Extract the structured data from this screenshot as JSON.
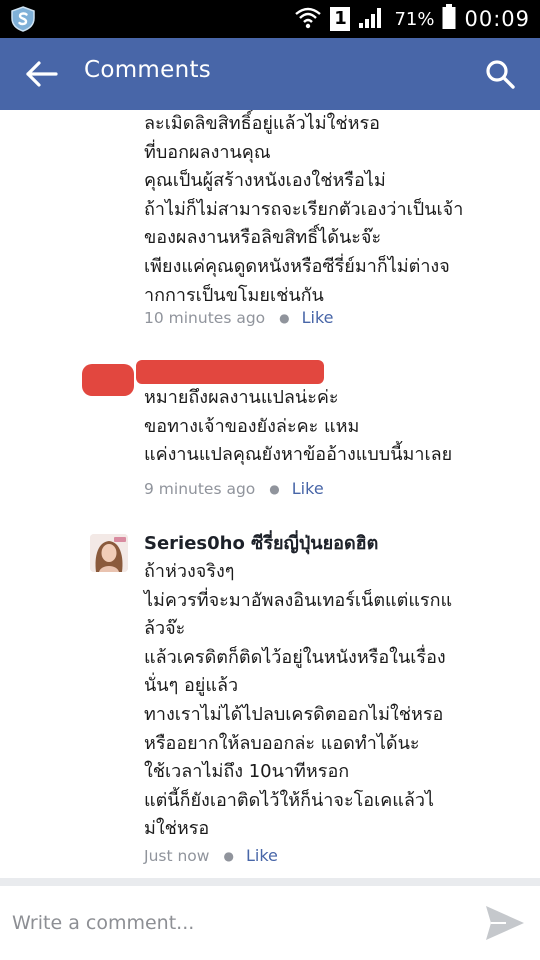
{
  "status_bar": {
    "battery_percent": "71%",
    "sim_slot": "1",
    "time": "00:09"
  },
  "header": {
    "title": "Comments"
  },
  "comments": [
    {
      "lines": [
        "ละเมิดลิขสิทธิ์อยู่แล้วไม่ใช่หรอ",
        "ที่บอกผลงานคุณ",
        "คุณเป็นผู้สร้างหนังเองใช่หรือไม่",
        "ถ้าไม่ก็ไม่สามารถจะเรียกตัวเองว่าเป็นเจ้า",
        "ของผลงานหรือลิขสิทธิ์ได้นะจ๊ะ",
        "เพียงแค่คุณดูดหนังหรือซีรี่ย์มาก็ไม่ต่างจ",
        "ากการเป็นขโมยเช่นกัน"
      ],
      "time": "10 minutes ago",
      "like": "Like"
    },
    {
      "lines": [
        "หมายถึงผลงานแปลน่ะค่ะ",
        "ขอทางเจ้าของยังล่ะคะ แหม",
        "แค่งานแปลคุณยังหาข้ออ้างแบบนี้มาเลย"
      ],
      "time": "9 minutes ago",
      "like": "Like"
    },
    {
      "author": "Series0ho ซีรี่ยญี่ปุ่นยอดฮิต",
      "lines": [
        "ถ้าห่วงจริงๆ",
        "ไม่ควรที่จะมาอัพลงอินเทอร์เน็ตแต่แรกแ",
        "ล้วจ๊ะ",
        "แล้วเครดิตก็ติดไว้อยู่ในหนังหรือในเรื่อง",
        "นั่นๆ อยู่แล้ว",
        "ทางเราไม่ได้ไปลบเครดิตออกไม่ใช่หรอ",
        "หรืออยากให้ลบออกล่ะ แอดทำได้นะ",
        "ใช้เวลาไม่ถึง 10นาทีหรอก",
        "แต่นี้ก็ยังเอาติดไว้ให้ก็น่าจะโอเคแล้วไ",
        "ม่ใช่หรอ"
      ],
      "time": "Just now",
      "like": "Like"
    }
  ],
  "composer": {
    "placeholder": "Write a comment..."
  },
  "colors": {
    "brand": "#4866a8",
    "redaction": "#e2473f",
    "meta": "#90949c"
  },
  "icons": [
    "shield-icon",
    "wifi-icon",
    "signal-icon",
    "battery-icon",
    "back-arrow-icon",
    "search-icon",
    "send-icon"
  ]
}
